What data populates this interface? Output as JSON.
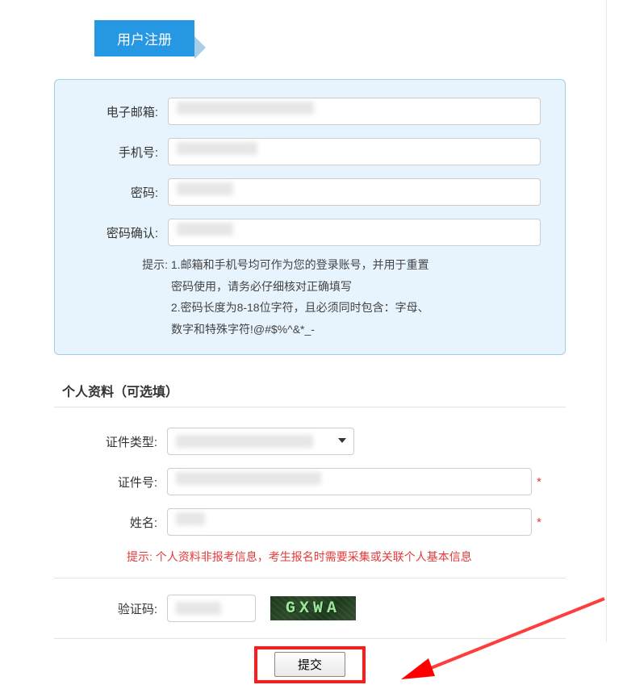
{
  "header": {
    "tab_label": "用户注册"
  },
  "account": {
    "email_label": "电子邮箱:",
    "phone_label": "手机号:",
    "password_label": "密码:",
    "password_confirm_label": "密码确认:"
  },
  "hints": {
    "label": "提示:",
    "line1a": "1.邮箱和手机号均可作为您的登录账号，并用于重置",
    "line1b": "密码使用，请务必仔细核对正确填写",
    "line2a": "2.密码长度为8-18位字符，且必须同时包含：字母、",
    "line2b": "数字和特殊字符!@#$%^&*_-"
  },
  "personal": {
    "section_title": "个人资料（可选填）",
    "idtype_label": "证件类型:",
    "idnumber_label": "证件号:",
    "name_label": "姓名:",
    "required_mark": "*",
    "red_hint_label": "提示:",
    "red_hint_text": "个人资料非报考信息，考生报名时需要采集或关联个人基本信息"
  },
  "captcha": {
    "label": "验证码:",
    "image_text": "GXWA"
  },
  "submit": {
    "button_label": "提交"
  }
}
